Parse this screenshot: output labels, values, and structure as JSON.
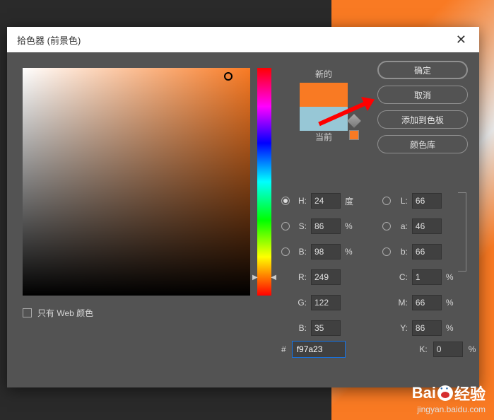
{
  "dialog": {
    "title": "拾色器 (前景色)",
    "close": "✕"
  },
  "preview": {
    "new_label": "新的",
    "current_label": "当前"
  },
  "buttons": {
    "ok": "确定",
    "cancel": "取消",
    "add_swatch": "添加到色板",
    "color_lib": "颜色库"
  },
  "fields": {
    "H": {
      "label": "H:",
      "value": "24",
      "unit": "度"
    },
    "S": {
      "label": "S:",
      "value": "86",
      "unit": "%"
    },
    "Bb": {
      "label": "B:",
      "value": "98",
      "unit": "%"
    },
    "L": {
      "label": "L:",
      "value": "66"
    },
    "a": {
      "label": "a:",
      "value": "46"
    },
    "b": {
      "label": "b:",
      "value": "66"
    },
    "R": {
      "label": "R:",
      "value": "249"
    },
    "G": {
      "label": "G:",
      "value": "122"
    },
    "Bv": {
      "label": "B:",
      "value": "35"
    },
    "C": {
      "label": "C:",
      "value": "1",
      "unit": "%"
    },
    "M": {
      "label": "M:",
      "value": "66",
      "unit": "%"
    },
    "Y": {
      "label": "Y:",
      "value": "86",
      "unit": "%"
    },
    "K": {
      "label": "K:",
      "value": "0",
      "unit": "%"
    }
  },
  "hex": {
    "label": "#",
    "value": "f97a23"
  },
  "webonly": {
    "label": "只有 Web 颜色"
  },
  "watermark": {
    "brand_pre": "Bai",
    "brand_post": "经验",
    "url": "jingyan.baidu.com"
  }
}
